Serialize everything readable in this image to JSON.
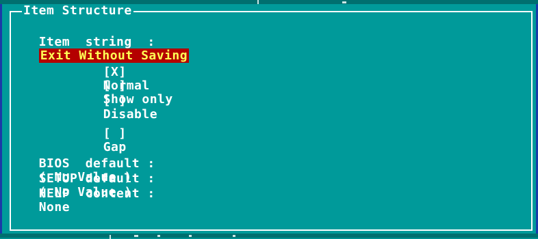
{
  "frame": {
    "title": "Item Structure"
  },
  "item_string": {
    "label": "Item  string  :",
    "value": "Exit Without Saving"
  },
  "mode_options": [
    {
      "box": "[X]",
      "label": "Normal"
    },
    {
      "box": "[ ]",
      "label": "Show only"
    },
    {
      "box": "[ ]",
      "label": "Disable"
    }
  ],
  "gap_option": {
    "box": "[ ]",
    "label": "Gap"
  },
  "defaults": [
    {
      "label": "BIOS  default :",
      "value": "( No Value )"
    },
    {
      "label": "SETUP default :",
      "value": "( No Value )"
    },
    {
      "label": "HELP  content :",
      "value": "None"
    }
  ]
}
